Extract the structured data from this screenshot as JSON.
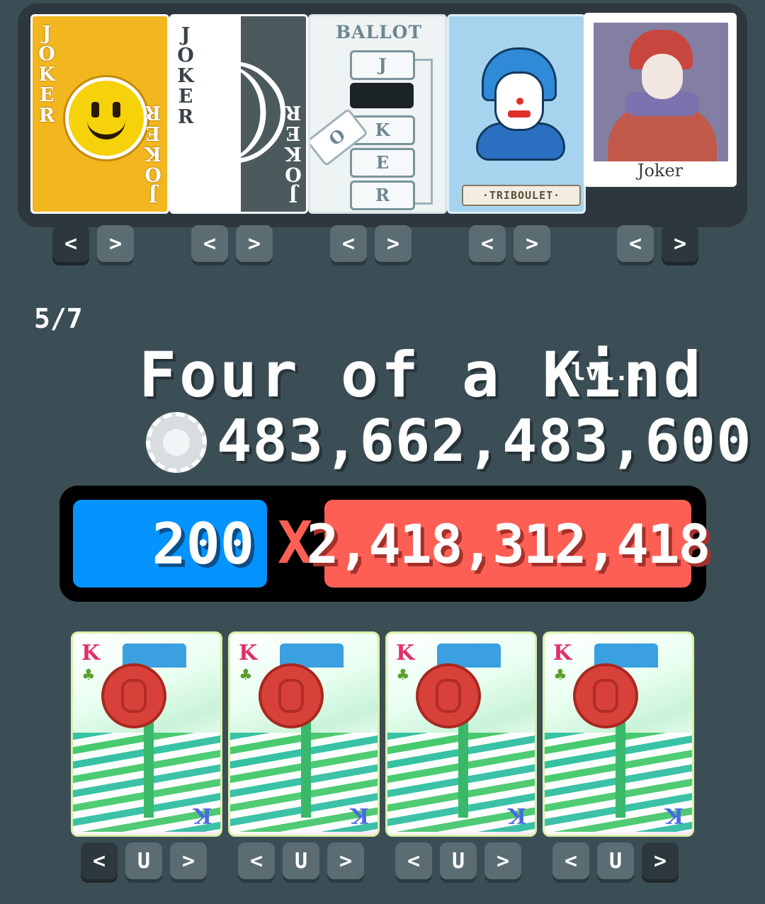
{
  "jokers": [
    {
      "name": "Joker",
      "corner_text": "JOKER",
      "icon": "smiley-face-icon"
    },
    {
      "name": "Joker",
      "corner_text": "JOKER",
      "icon": "shadow-face-icon"
    },
    {
      "name": "Joker",
      "title": "BALLOT",
      "letters": [
        "J",
        "O",
        "K",
        "E",
        "R"
      ],
      "icon": "ballot-icon"
    },
    {
      "name": "Triboulet",
      "plate": "·TRIBOULET·",
      "icon": "jester-icon"
    },
    {
      "name": "Joker",
      "caption": "Joker",
      "icon": "photograph-jester-icon"
    }
  ],
  "nav": {
    "prev": "<",
    "next": ">",
    "up": "U"
  },
  "hand": {
    "counter": "5/7",
    "name": "Four of a Kind",
    "level": "lvl.1",
    "chip_total": "483,662,483,600",
    "chips": "200",
    "times": "X",
    "mult": "2,418,312,418"
  },
  "played_cards": [
    {
      "rank": "K",
      "suit": "clubs",
      "edition": "polychrome",
      "seal": "red"
    },
    {
      "rank": "K",
      "suit": "clubs",
      "edition": "polychrome",
      "seal": "red"
    },
    {
      "rank": "K",
      "suit": "clubs",
      "edition": "polychrome",
      "seal": "red"
    },
    {
      "rank": "K",
      "suit": "clubs",
      "edition": "polychrome",
      "seal": "red"
    }
  ],
  "colors": {
    "chips": "#0593ff",
    "mult": "#fe5f55",
    "background": "#3c4e55"
  }
}
